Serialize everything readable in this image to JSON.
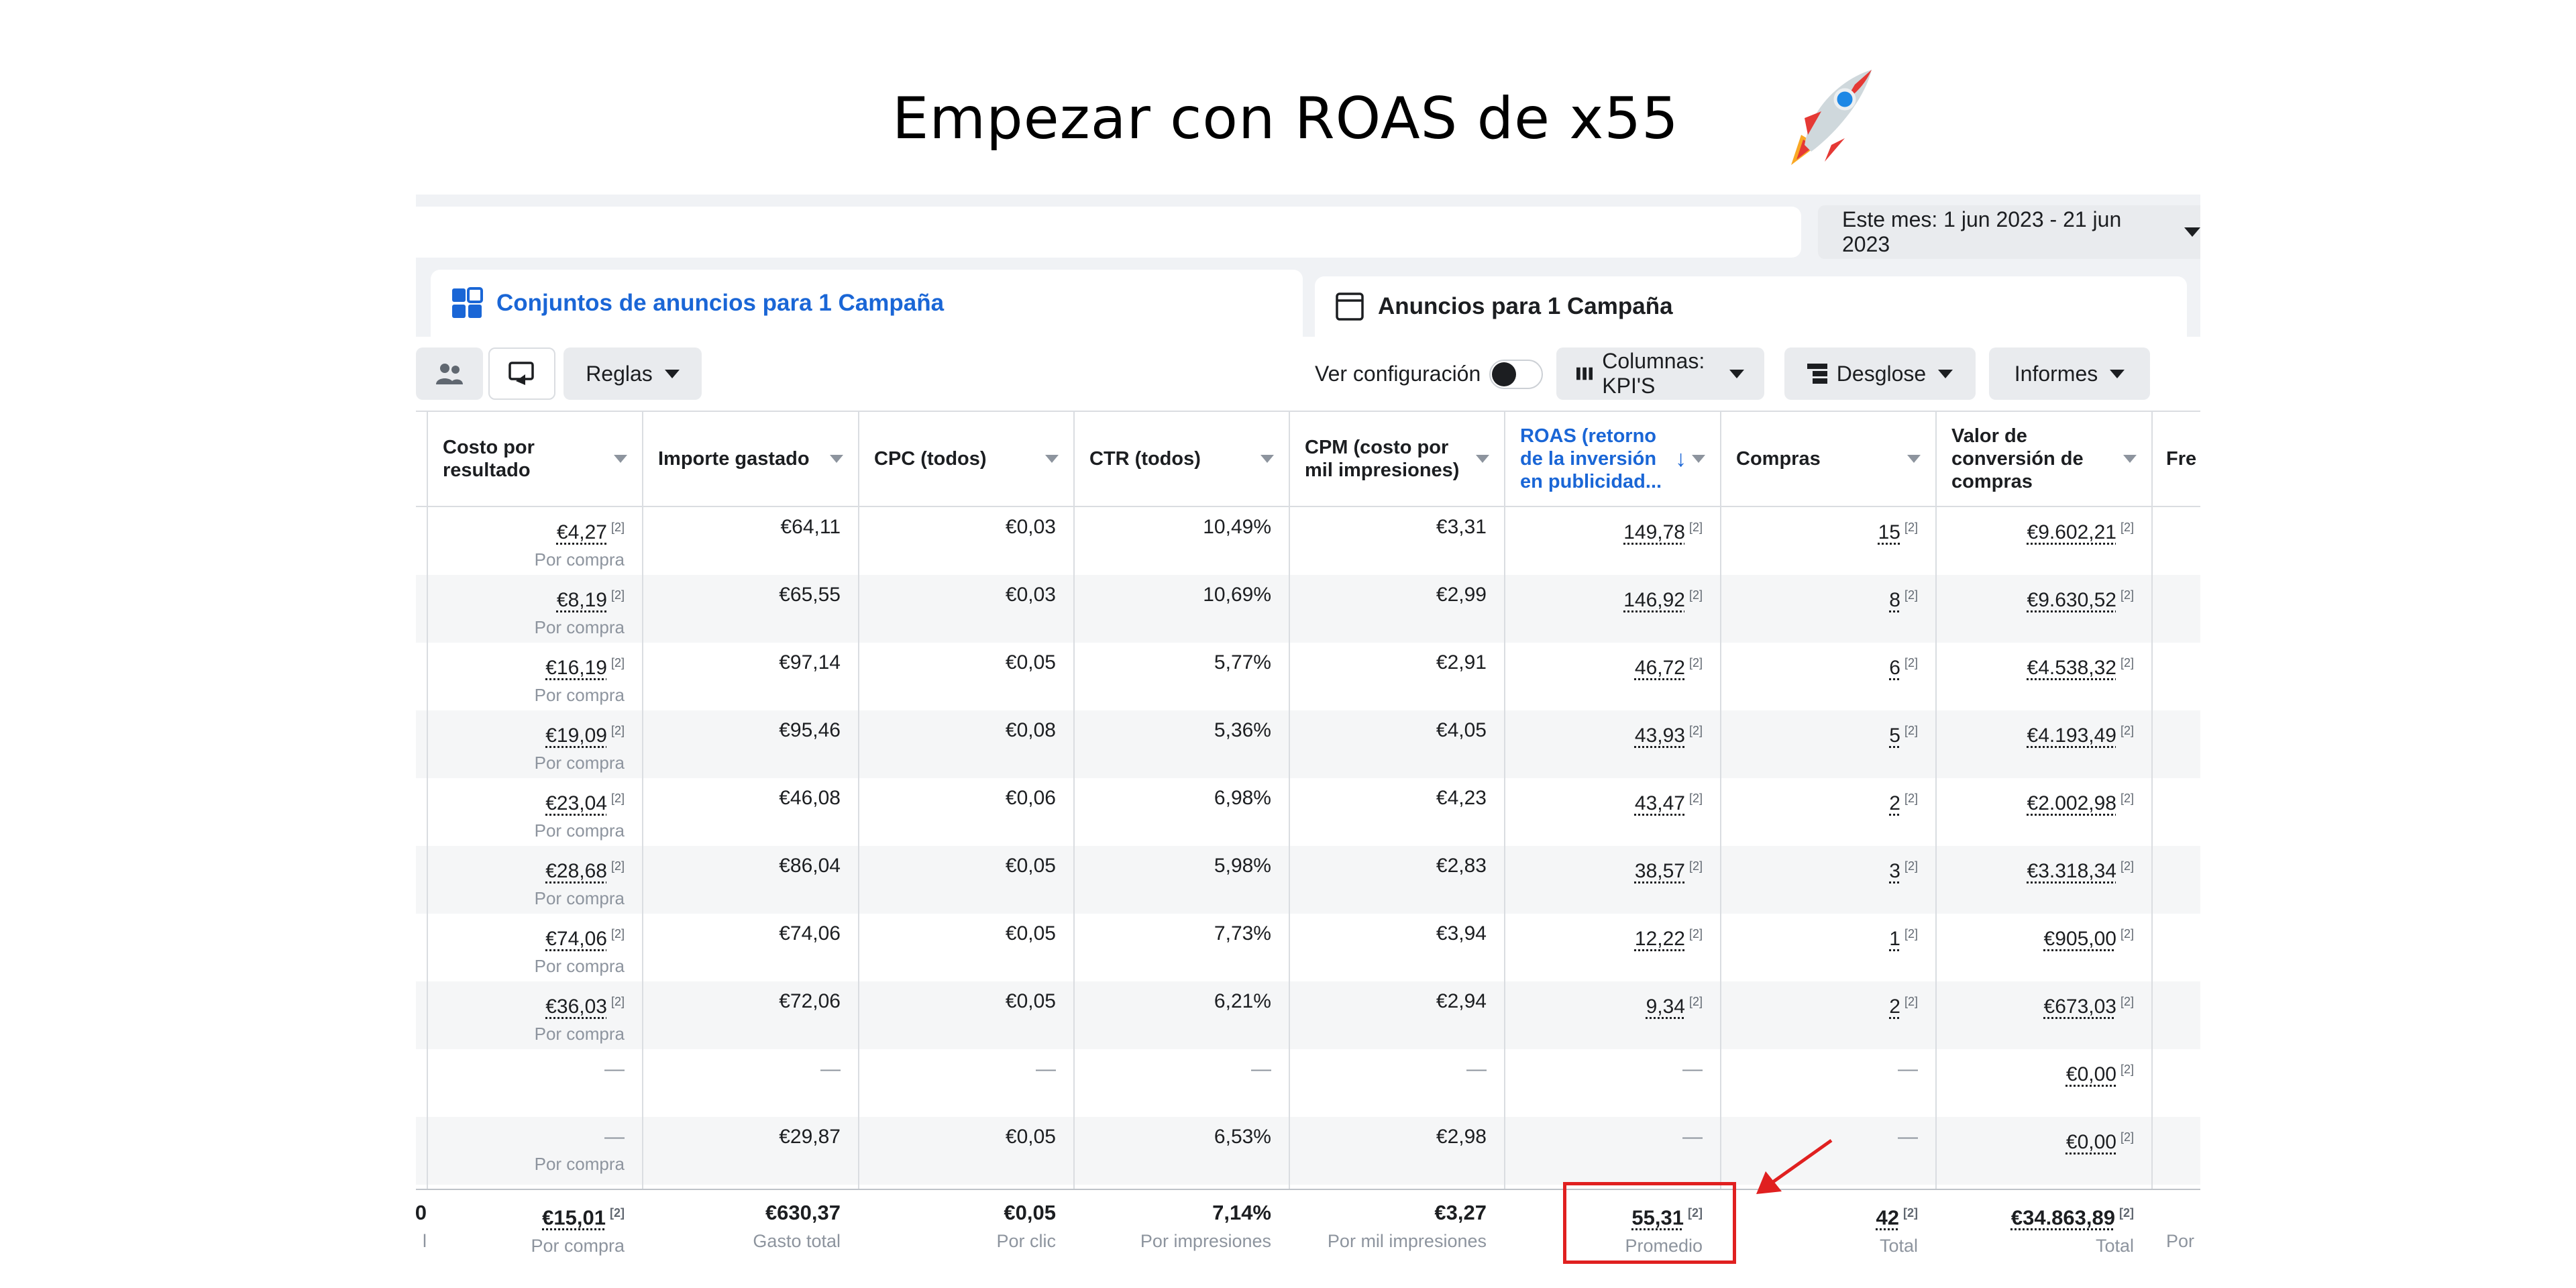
{
  "headline": "Empezar con ROAS de x55",
  "date_range": "Este mes: 1 jun 2023 - 21 jun 2023",
  "tabs": [
    {
      "label": "Conjuntos de anuncios para 1 Campaña"
    },
    {
      "label": "Anuncios para 1 Campaña"
    }
  ],
  "toolbar": {
    "rules": "Reglas",
    "view_settings": "Ver configuración",
    "columns": "Columnas: KPI'S",
    "breakdown": "Desglose",
    "reports": "Informes"
  },
  "columns": [
    {
      "label": "Costo por resultado"
    },
    {
      "label": "Importe gastado"
    },
    {
      "label": "CPC (todos)"
    },
    {
      "label": "CTR (todos)"
    },
    {
      "label": "CPM (costo por mil impresiones)"
    },
    {
      "label": "ROAS (retorno de la inversión en publicidad...",
      "sort": "↓"
    },
    {
      "label": "Compras"
    },
    {
      "label": "Valor de conversión de compras"
    },
    {
      "label": "Fre"
    }
  ],
  "footnote": "[2]",
  "rows": [
    {
      "cost": "€4,27",
      "cost_sub": "Por compra",
      "spent": "€64,11",
      "cpc": "€0,03",
      "ctr": "10,49%",
      "cpm": "€3,31",
      "roas": "149,78",
      "purchases": "15",
      "value": "€9.602,21"
    },
    {
      "cost": "€8,19",
      "cost_sub": "Por compra",
      "spent": "€65,55",
      "cpc": "€0,03",
      "ctr": "10,69%",
      "cpm": "€2,99",
      "roas": "146,92",
      "purchases": "8",
      "value": "€9.630,52"
    },
    {
      "cost": "€16,19",
      "cost_sub": "Por compra",
      "spent": "€97,14",
      "cpc": "€0,05",
      "ctr": "5,77%",
      "cpm": "€2,91",
      "roas": "46,72",
      "purchases": "6",
      "value": "€4.538,32"
    },
    {
      "cost": "€19,09",
      "cost_sub": "Por compra",
      "spent": "€95,46",
      "cpc": "€0,08",
      "ctr": "5,36%",
      "cpm": "€4,05",
      "roas": "43,93",
      "purchases": "5",
      "value": "€4.193,49"
    },
    {
      "cost": "€23,04",
      "cost_sub": "Por compra",
      "spent": "€46,08",
      "cpc": "€0,06",
      "ctr": "6,98%",
      "cpm": "€4,23",
      "roas": "43,47",
      "purchases": "2",
      "value": "€2.002,98"
    },
    {
      "cost": "€28,68",
      "cost_sub": "Por compra",
      "spent": "€86,04",
      "cpc": "€0,05",
      "ctr": "5,98%",
      "cpm": "€2,83",
      "roas": "38,57",
      "purchases": "3",
      "value": "€3.318,34"
    },
    {
      "cost": "€74,06",
      "cost_sub": "Por compra",
      "spent": "€74,06",
      "cpc": "€0,05",
      "ctr": "7,73%",
      "cpm": "€3,94",
      "roas": "12,22",
      "purchases": "1",
      "value": "€905,00"
    },
    {
      "cost": "€36,03",
      "cost_sub": "Por compra",
      "spent": "€72,06",
      "cpc": "€0,05",
      "ctr": "6,21%",
      "cpm": "€2,94",
      "roas": "9,34",
      "purchases": "2",
      "value": "€673,03"
    },
    {
      "cost": "—",
      "cost_sub": "",
      "spent": "—",
      "cpc": "—",
      "ctr": "—",
      "cpm": "—",
      "roas": "—",
      "purchases": "—",
      "value": "€0,00"
    },
    {
      "cost": "—",
      "cost_sub": "Por compra",
      "spent": "€29,87",
      "cpc": "€0,05",
      "ctr": "6,53%",
      "cpm": "€2,98",
      "roas": "—",
      "purchases": "—",
      "value": "€0,00"
    }
  ],
  "totals": {
    "cost": "€15,01",
    "cost_sub": "Por compra",
    "spent": "€630,37",
    "spent_sub": "Gasto total",
    "cpc": "€0,05",
    "cpc_sub": "Por clic",
    "ctr": "7,14%",
    "ctr_sub": "Por impresiones",
    "cpm": "€3,27",
    "cpm_sub": "Por mil impresiones",
    "roas": "55,31",
    "roas_sub": "Promedio",
    "purchases": "42",
    "purchases_sub": "Total",
    "value": "€34.863,89",
    "value_sub": "Total",
    "freq_sub": "Por"
  },
  "colors": {
    "accent_blue": "#1a66d6",
    "highlight_red": "#e02020"
  },
  "icons": [
    "rocket-icon",
    "ad-sets-grid-icon",
    "ads-window-icon",
    "people-icon",
    "share-icon",
    "columns-icon",
    "breakdown-icon",
    "caret-down-icon",
    "sort-arrow-icon",
    "red-arrow-icon"
  ]
}
